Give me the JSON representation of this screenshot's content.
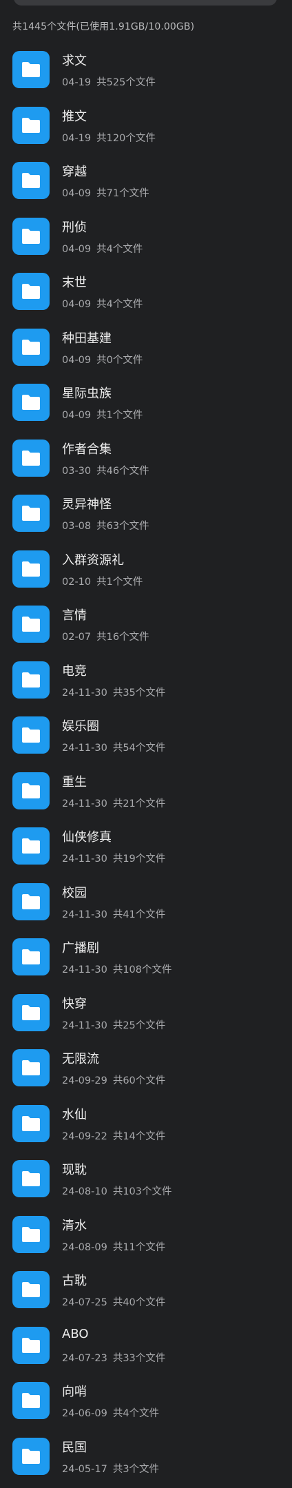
{
  "summary": "共1445个文件(已使用1.91GB/10.00GB)",
  "folders": [
    {
      "name": "求文",
      "date": "04-19",
      "count": "共525个文件"
    },
    {
      "name": "推文",
      "date": "04-19",
      "count": "共120个文件"
    },
    {
      "name": "穿越",
      "date": "04-09",
      "count": "共71个文件"
    },
    {
      "name": "刑侦",
      "date": "04-09",
      "count": "共4个文件"
    },
    {
      "name": "末世",
      "date": "04-09",
      "count": "共4个文件"
    },
    {
      "name": "种田基建",
      "date": "04-09",
      "count": "共0个文件"
    },
    {
      "name": "星际虫族",
      "date": "04-09",
      "count": "共1个文件"
    },
    {
      "name": "作者合集",
      "date": "03-30",
      "count": "共46个文件"
    },
    {
      "name": "灵异神怪",
      "date": "03-08",
      "count": "共63个文件"
    },
    {
      "name": "入群资源礼",
      "date": "02-10",
      "count": "共1个文件"
    },
    {
      "name": "言情",
      "date": "02-07",
      "count": "共16个文件"
    },
    {
      "name": "电竞",
      "date": "24-11-30",
      "count": "共35个文件"
    },
    {
      "name": "娱乐圈",
      "date": "24-11-30",
      "count": "共54个文件"
    },
    {
      "name": "重生",
      "date": "24-11-30",
      "count": "共21个文件"
    },
    {
      "name": "仙侠修真",
      "date": "24-11-30",
      "count": "共19个文件"
    },
    {
      "name": "校园",
      "date": "24-11-30",
      "count": "共41个文件"
    },
    {
      "name": "广播剧",
      "date": "24-11-30",
      "count": "共108个文件"
    },
    {
      "name": "快穿",
      "date": "24-11-30",
      "count": "共25个文件"
    },
    {
      "name": "无限流",
      "date": "24-09-29",
      "count": "共60个文件"
    },
    {
      "name": "水仙",
      "date": "24-09-22",
      "count": "共14个文件"
    },
    {
      "name": "现耽",
      "date": "24-08-10",
      "count": "共103个文件"
    },
    {
      "name": "清水",
      "date": "24-08-09",
      "count": "共11个文件"
    },
    {
      "name": "古耽",
      "date": "24-07-25",
      "count": "共40个文件"
    },
    {
      "name": "ABO",
      "date": "24-07-23",
      "count": "共33个文件"
    },
    {
      "name": "向哨",
      "date": "24-06-09",
      "count": "共4个文件"
    },
    {
      "name": "民国",
      "date": "24-05-17",
      "count": "共3个文件"
    }
  ],
  "icon": "folder-icon",
  "colors": {
    "background": "#1f2022",
    "folder": "#1e9bf0"
  }
}
